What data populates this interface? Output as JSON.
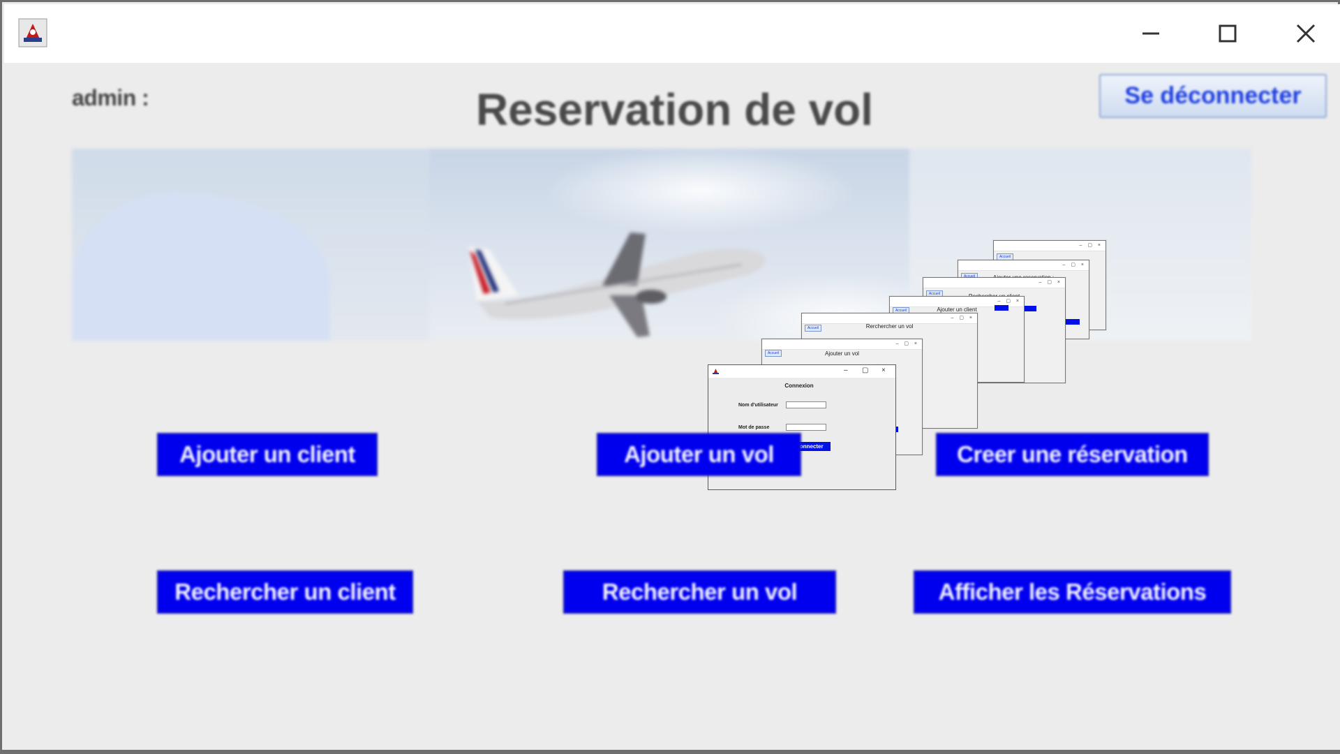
{
  "window": {
    "icon": "java-app-icon",
    "controls": [
      "minimize-icon",
      "maximize-icon",
      "close-icon"
    ]
  },
  "header": {
    "user_label": "admin :",
    "title": "Reservation de vol",
    "logout_label": "Se déconnecter"
  },
  "banner": {
    "image": "airplane-taking-off-in-cloudy-sky",
    "windows": {
      "w1_title": "",
      "w2_title": "Ajouter une reservation :",
      "w3_title": "Rechercher un client",
      "w4_title": "Ajouter un client",
      "w5_title": "Rerchercher un vol",
      "w6_title": "Ajouter un vol",
      "accueil": "Accueil",
      "login_title": "Connexion",
      "login_user_label": "Nom d'utilisateur",
      "login_pass_label": "Mot de passe",
      "login_button": "Se connecter"
    }
  },
  "actions": {
    "add_client": "Ajouter un client",
    "add_flight": "Ajouter un vol",
    "create_reservation": "Creer une réservation",
    "search_client": "Rechercher un client",
    "search_flight": "Rechercher un vol",
    "show_reservations": "Afficher les Réservations"
  },
  "colors": {
    "button_blue": "#0000ee",
    "background": "#ececec",
    "title_text": "#4a4a4a"
  }
}
